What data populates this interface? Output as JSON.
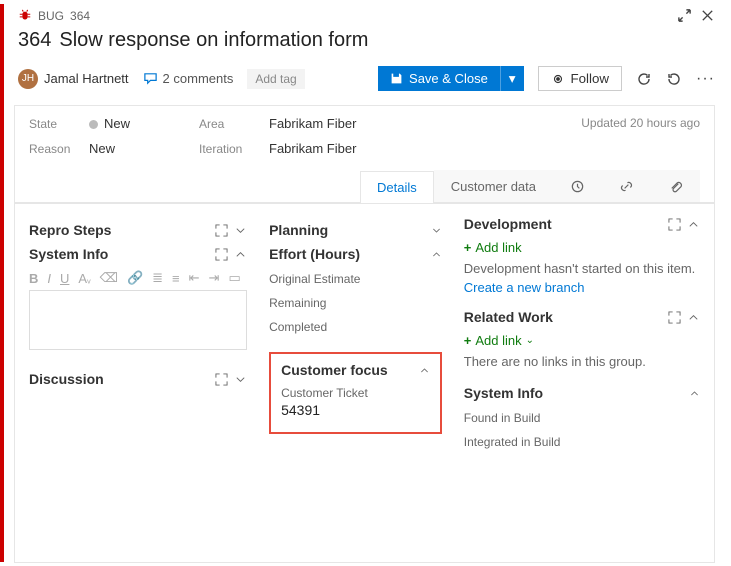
{
  "breadcrumb": {
    "type": "BUG",
    "id": "364"
  },
  "title": {
    "id": "364",
    "text": "Slow response on information form"
  },
  "assignee": {
    "name": "Jamal Hartnett",
    "initials": "JH"
  },
  "comments": {
    "count_label": "2 comments"
  },
  "add_tag_label": "Add tag",
  "save_label": "Save & Close",
  "follow_label": "Follow",
  "meta": {
    "state_label": "State",
    "state_val": "New",
    "reason_label": "Reason",
    "reason_val": "New",
    "area_label": "Area",
    "area_val": "Fabrikam Fiber",
    "iter_label": "Iteration",
    "iter_val": "Fabrikam Fiber",
    "updated": "Updated 20 hours ago"
  },
  "tabs": {
    "details": "Details",
    "custdata": "Customer data"
  },
  "col1": {
    "repro": "Repro Steps",
    "sysinfo": "System Info",
    "discussion": "Discussion"
  },
  "col2": {
    "planning": "Planning",
    "effort": "Effort (Hours)",
    "orig": "Original Estimate",
    "remaining": "Remaining",
    "completed": "Completed",
    "custfocus": "Customer focus",
    "custticket_lbl": "Customer Ticket",
    "custticket_val": "54391"
  },
  "col3": {
    "dev": "Development",
    "add_link": "Add link",
    "dev_msg": "Development hasn't started on this item.",
    "create_branch": "Create a new branch",
    "related": "Related Work",
    "no_links": "There are no links in this group.",
    "sysinfo": "System Info",
    "found": "Found in Build",
    "integrated": "Integrated in Build"
  }
}
